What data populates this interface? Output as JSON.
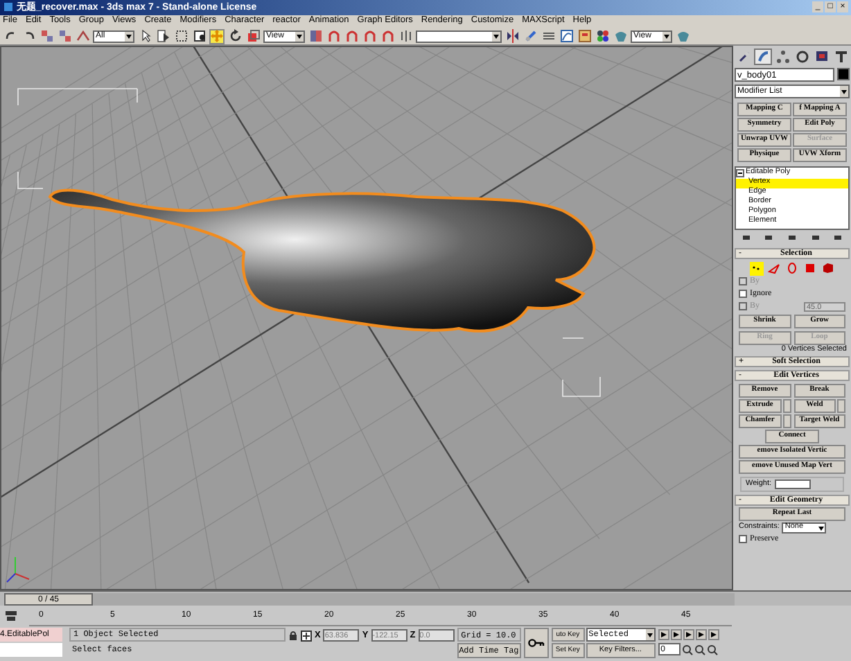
{
  "window": {
    "title": "无题_recover.max - 3ds max 7  - Stand-alone License",
    "controls": [
      "_",
      "□",
      "×"
    ]
  },
  "menu": [
    "File",
    "Edit",
    "Tools",
    "Group",
    "Views",
    "Create",
    "Modifiers",
    "Character",
    "reactor",
    "Animation",
    "Graph Editors",
    "Rendering",
    "Customize",
    "MAXScript",
    "Help"
  ],
  "toolbar": [
    {
      "kind": "undo",
      "selected": false
    },
    {
      "kind": "redo",
      "selected": false
    },
    {
      "kind": "link",
      "selected": false
    },
    {
      "kind": "unlink",
      "selected": false
    },
    {
      "kind": "bind",
      "selected": false
    },
    {
      "kind": "dropdown",
      "value": "All"
    },
    {
      "kind": "select",
      "selected": false
    },
    {
      "kind": "select-name",
      "selected": false
    },
    {
      "kind": "region",
      "selected": false
    },
    {
      "kind": "crossing",
      "selected": false
    },
    {
      "kind": "move",
      "selected": true
    },
    {
      "kind": "rotate",
      "selected": false
    },
    {
      "kind": "scale",
      "selected": false
    },
    {
      "kind": "dropdown",
      "value": "View"
    },
    {
      "kind": "pivot",
      "selected": false
    },
    {
      "kind": "snap",
      "selected": false
    },
    {
      "kind": "snap",
      "selected": false
    },
    {
      "kind": "snap",
      "selected": false
    },
    {
      "kind": "snap",
      "selected": false
    },
    {
      "kind": "spinner",
      "selected": false
    },
    {
      "kind": "named"
    },
    {
      "kind": "mirror",
      "selected": false
    },
    {
      "kind": "align",
      "selected": false
    },
    {
      "kind": "layers",
      "selected": false
    },
    {
      "kind": "curve",
      "selected": false
    },
    {
      "kind": "schematic",
      "selected": false
    },
    {
      "kind": "material",
      "selected": false
    },
    {
      "kind": "render",
      "selected": false
    },
    {
      "kind": "dropdown",
      "value": "View"
    },
    {
      "kind": "render",
      "selected": false
    }
  ],
  "viewport": {
    "frame": "0 / 45"
  },
  "trackbar": {
    "ticks": [
      "0",
      "5",
      "10",
      "15",
      "20",
      "25",
      "30",
      "35",
      "40",
      "45"
    ]
  },
  "command_panel": {
    "tabs": [
      {
        "kind": "create",
        "selected": false
      },
      {
        "kind": "modify",
        "selected": true
      },
      {
        "kind": "hierarchy",
        "selected": false
      },
      {
        "kind": "motion",
        "selected": false
      },
      {
        "kind": "display",
        "selected": false
      },
      {
        "kind": "utilities",
        "selected": false
      }
    ],
    "object_name": "v_body01",
    "modifier_list": "Modifier List",
    "modifier_buttons": [
      {
        "label": "Mapping C",
        "disabled": false
      },
      {
        "label": "f Mapping A",
        "disabled": false
      },
      {
        "label": "Symmetry",
        "disabled": false
      },
      {
        "label": "Edit Poly",
        "disabled": false
      },
      {
        "label": "Unwrap UVW",
        "disabled": false
      },
      {
        "label": "Surface",
        "disabled": true
      },
      {
        "label": "Physique",
        "disabled": false
      },
      {
        "label": "UVW Xform",
        "disabled": false
      }
    ],
    "stack": [
      {
        "label": "Editable Poly",
        "expanded": true,
        "selected": false,
        "children": [
          {
            "label": "Vertex",
            "selected": true
          },
          {
            "label": "Edge",
            "selected": false
          },
          {
            "label": "Border",
            "selected": false
          },
          {
            "label": "Polygon",
            "selected": false
          },
          {
            "label": "Element",
            "selected": false
          }
        ]
      }
    ],
    "selection": {
      "title": "Selection",
      "sign": "-",
      "levels": [
        {
          "kind": "vertex",
          "selected": true
        },
        {
          "kind": "edge",
          "selected": false
        },
        {
          "kind": "border",
          "selected": false
        },
        {
          "kind": "polygon",
          "selected": false
        },
        {
          "kind": "element",
          "selected": false
        }
      ],
      "options": [
        {
          "label": "By",
          "checked": false,
          "disabled": true
        },
        {
          "label": "Ignore",
          "checked": false,
          "disabled": false
        },
        {
          "label": "By",
          "checked": false,
          "disabled": true,
          "value": "45.0"
        }
      ],
      "buttons": [
        {
          "label": "Shrink",
          "disabled": false
        },
        {
          "label": "Grow",
          "disabled": false
        },
        {
          "label": "Ring",
          "disabled": true
        },
        {
          "label": "Loop",
          "disabled": true
        }
      ],
      "status": "0 Vertices Selected"
    },
    "soft_selection": {
      "title": "Soft Selection",
      "sign": "+"
    },
    "edit_vertices": {
      "title": "Edit Vertices",
      "sign": "-",
      "pairs": [
        {
          "label": "Remove",
          "settings": false
        },
        {
          "label": "Break",
          "settings": false
        },
        {
          "label": "Extrude",
          "settings": true
        },
        {
          "label": "Weld",
          "settings": true
        },
        {
          "label": "Chamfer",
          "settings": true
        },
        {
          "label": "Target Weld",
          "settings": false
        }
      ],
      "buttons": [
        "Connect",
        "emove Isolated Vertic",
        "emove Unused Map Vert"
      ],
      "weight_label": "Weight:"
    },
    "edit_geometry": {
      "title": "Edit Geometry",
      "sign": "-",
      "repeat": "Repeat Last",
      "constraints_label": "Constraints:",
      "constraints": "None",
      "preserve": {
        "label": "Preserve",
        "checked": false
      }
    }
  },
  "status_bar": {
    "script_listener": "4.EditablePol",
    "prompt": "1 Object Selected",
    "hint": "Select faces",
    "coordinates": [
      {
        "axis": "X",
        "value": "63.836"
      },
      {
        "axis": "Y",
        "value": "-122.15"
      },
      {
        "axis": "Z",
        "value": "0.0"
      }
    ],
    "grid": "Grid = 10.0",
    "time_tag": "Add Time Tag",
    "auto_key": "uto Key",
    "key_mode": "Selected",
    "set_key": "Set Key",
    "key_filters": "Key Filters...",
    "frame": "0"
  }
}
